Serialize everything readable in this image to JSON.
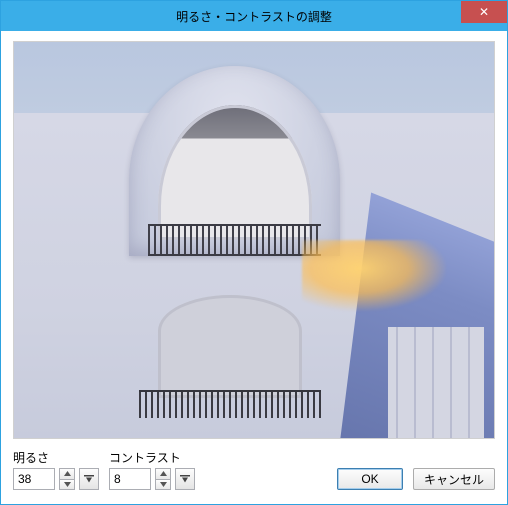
{
  "window": {
    "title": "明るさ・コントラストの調整",
    "close_glyph": "✕"
  },
  "fields": {
    "brightness": {
      "label": "明るさ",
      "value": "38"
    },
    "contrast": {
      "label": "コントラスト",
      "value": "8"
    }
  },
  "buttons": {
    "ok": "OK",
    "cancel": "キャンセル"
  }
}
